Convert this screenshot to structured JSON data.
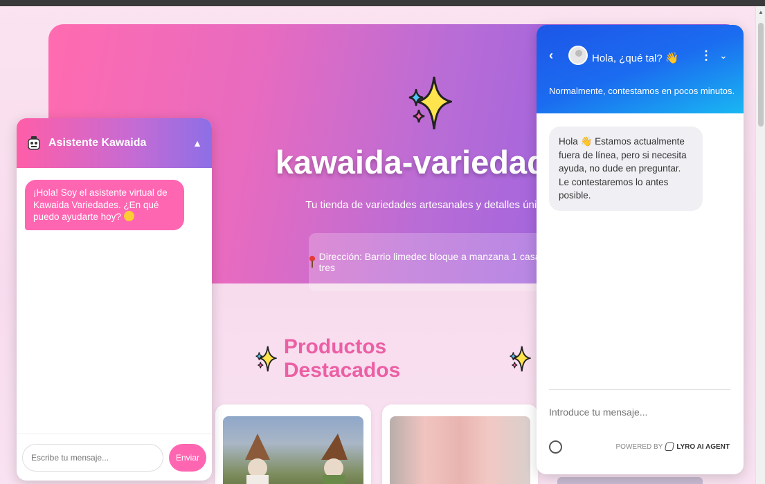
{
  "hero": {
    "title": "kawaida-variedades",
    "subtitle": "Tu tienda de variedades artesanales y detalles únicos",
    "address": "Dirección: Barrio limedec bloque a manzana 1 casa tres"
  },
  "products": {
    "heading": "Productos Destacados"
  },
  "left_chat": {
    "title": "Asistente Kawaida",
    "toggle_icon": "▲",
    "bot_message": "¡Hola! Soy el asistente virtual de Kawaida Variedades. ¿En qué puedo ayudarte hoy?",
    "input_placeholder": "Escribe tu mensaje...",
    "send_label": "Enviar"
  },
  "right_chat": {
    "back_icon": "‹",
    "greeting": "Hola, ¿qué tal?",
    "wave": "👋",
    "menu_icon": "⋮",
    "chevron_icon": "⌄",
    "reply_note": "Normalmente, contestamos en pocos minutos.",
    "agent_message_prefix": "Hola",
    "agent_message": "Estamos actualmente fuera de línea, pero si necesita ayuda, no dude en preguntar. Le contestaremos lo antes posible.",
    "input_placeholder": "Introduce tu mensaje...",
    "powered_by": "POWERED BY",
    "brand": "LYRO AI AGENT"
  },
  "colors": {
    "accent_pink": "#ff66b2",
    "hero_start": "#ff6bb0",
    "hero_end": "#8d5de0",
    "chat_blue": "#1d56e8"
  }
}
